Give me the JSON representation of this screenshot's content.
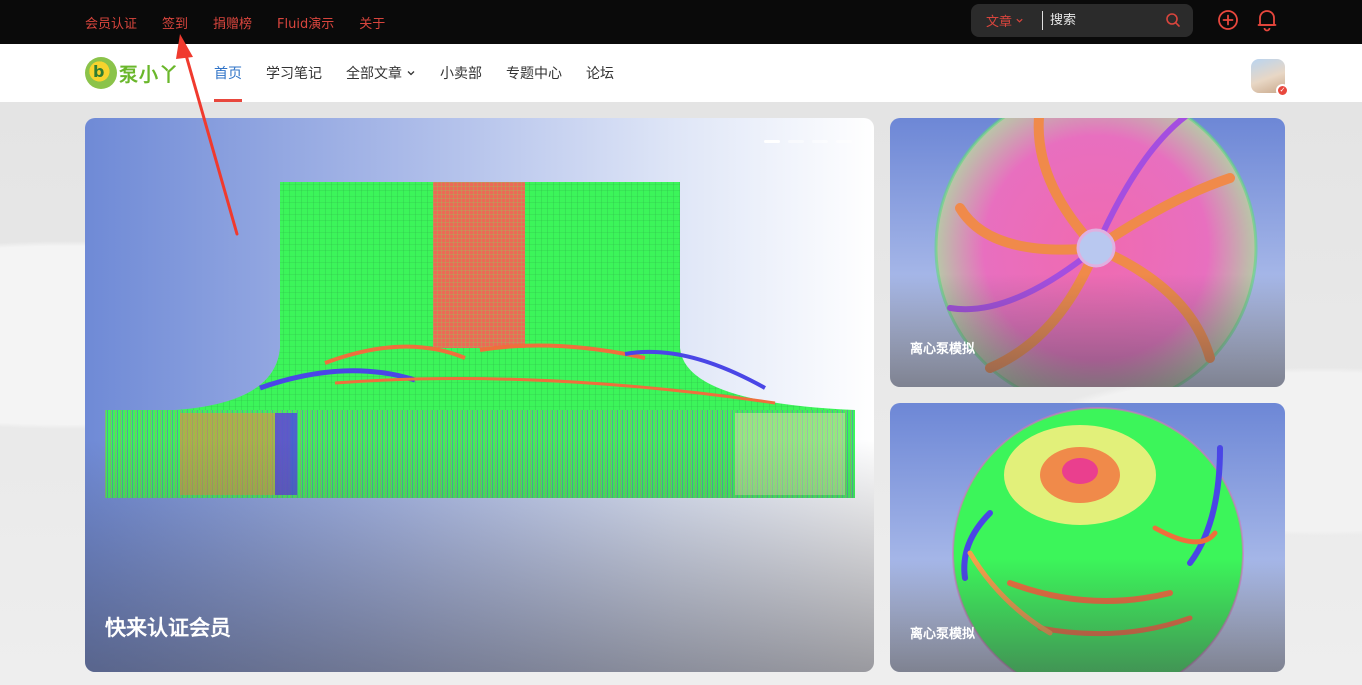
{
  "topbar": {
    "links": [
      {
        "label": "会员认证"
      },
      {
        "label": "签到"
      },
      {
        "label": "捐赠榜"
      },
      {
        "label": "Fluid演示"
      },
      {
        "label": "关于"
      }
    ],
    "search": {
      "type_label": "文章",
      "placeholder": "搜索"
    },
    "icons": [
      "plus-circle-icon",
      "bell-icon"
    ],
    "accent_color": "#d8453d"
  },
  "navbar": {
    "logo_text": "泵小丫",
    "menu": [
      {
        "label": "首页",
        "active": true
      },
      {
        "label": "学习笔记"
      },
      {
        "label": "全部文章",
        "has_dropdown": true
      },
      {
        "label": "小卖部"
      },
      {
        "label": "专题中心"
      },
      {
        "label": "论坛"
      }
    ],
    "active_color": "#2f73c7",
    "underline_color": "#e8473d"
  },
  "carousel": {
    "main_caption": "快来认证会员",
    "slide_count": 4,
    "active_slide": 1
  },
  "side_cards": [
    {
      "caption": "离心泵模拟"
    },
    {
      "caption": "离心泵模拟"
    }
  ],
  "annotation": {
    "arrow_color": "#f03a2e",
    "points_to": "签到"
  }
}
